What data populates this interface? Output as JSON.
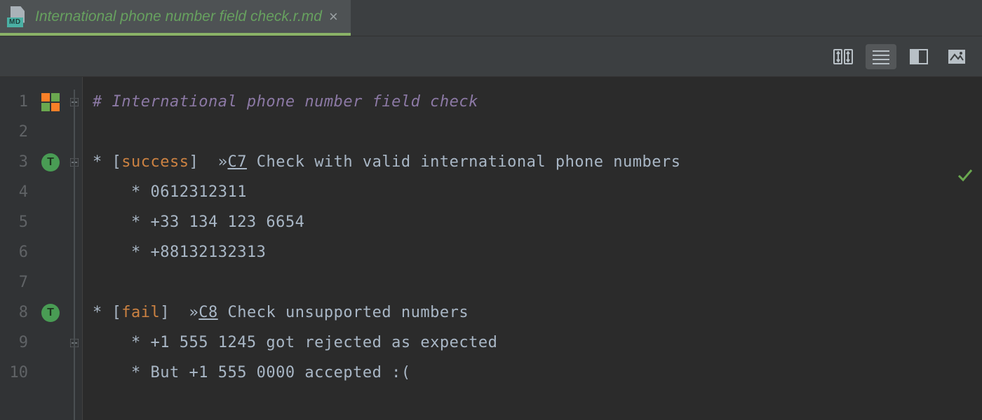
{
  "tab": {
    "filename": "International phone number field check.r.md",
    "icon_band": "MD"
  },
  "toolbar": {
    "scroll_sync": "scroll-sync",
    "editor_only": "editor-only",
    "split_view": "editor-and-preview",
    "preview_only": "preview-only"
  },
  "status": {
    "analysis_ok": "✓"
  },
  "lines": {
    "l1": {
      "hash": "#",
      "title": "International phone number field check"
    },
    "l3": {
      "star": "*",
      "lbr": "[",
      "tag": "success",
      "rbr": "]",
      "chev": "»",
      "cid": "C7",
      "text": "Check with valid international phone numbers"
    },
    "l4": {
      "star": "*",
      "text": "0612312311"
    },
    "l5": {
      "star": "*",
      "text": "+33 134 123 6654"
    },
    "l6": {
      "star": "*",
      "text": "+88132132313"
    },
    "l8": {
      "star": "*",
      "lbr": "[",
      "tag": "fail",
      "rbr": "]",
      "chev": "»",
      "cid": "C8",
      "text": "Check unsupported numbers"
    },
    "l9": {
      "star": "*",
      "text": "+1 555 1245 got rejected as expected"
    },
    "l10": {
      "star": "*",
      "text": "But +1 555 0000 accepted :("
    }
  },
  "gutter": [
    "1",
    "2",
    "3",
    "4",
    "5",
    "6",
    "7",
    "8",
    "9",
    "10"
  ]
}
